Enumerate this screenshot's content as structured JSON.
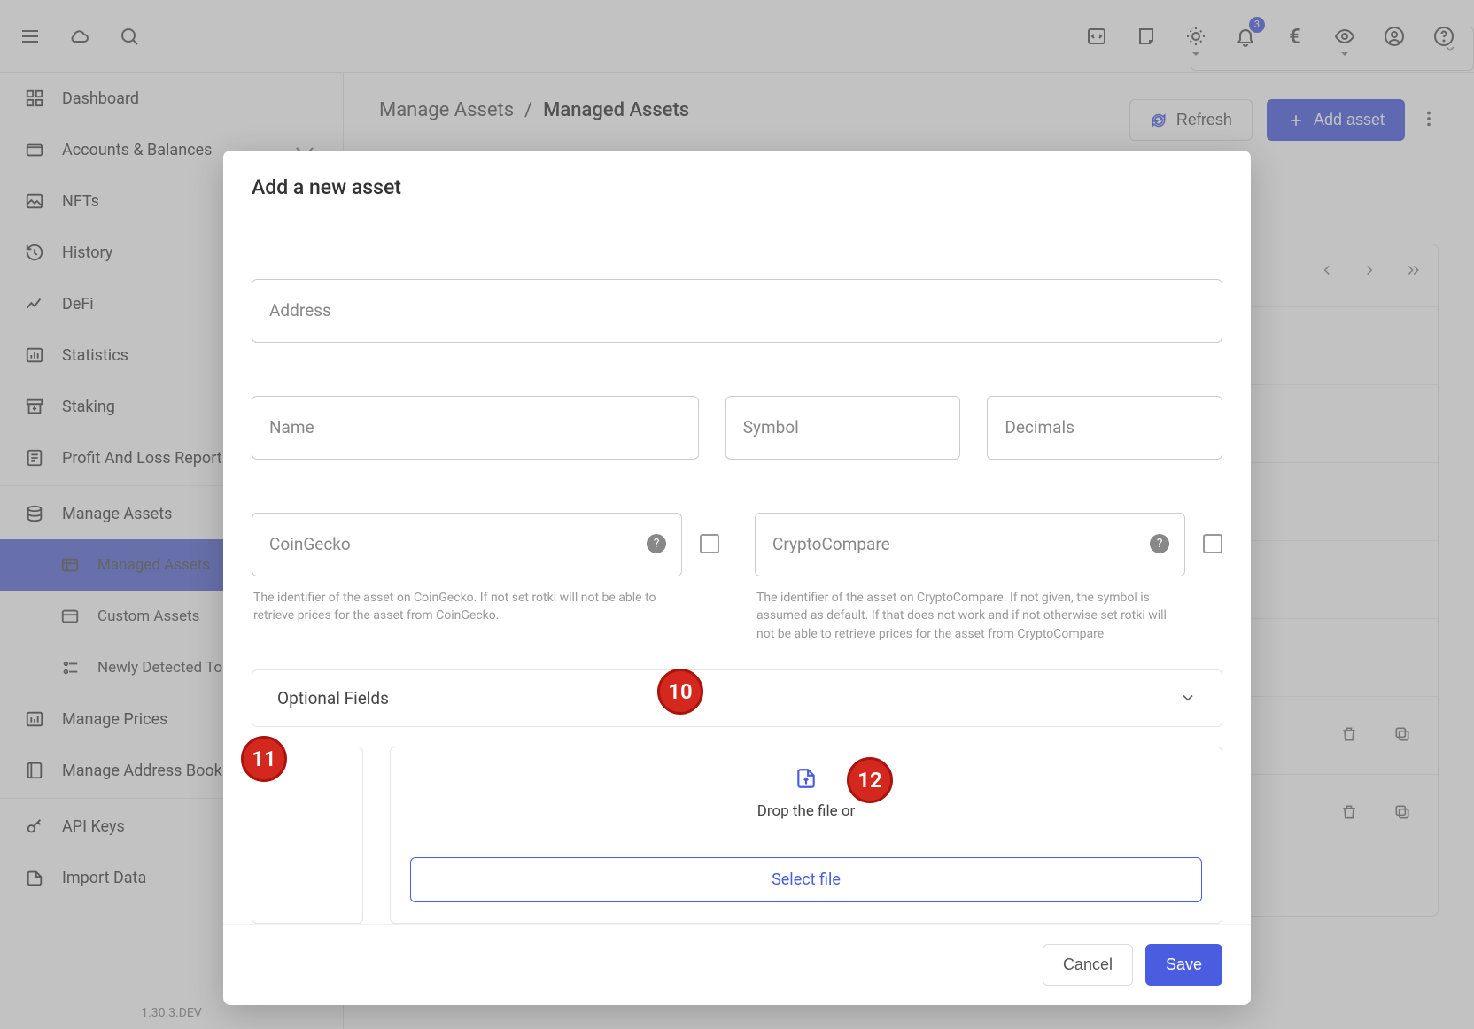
{
  "topbar": {
    "notifications_badge": "3"
  },
  "sidebar": {
    "items": [
      {
        "label": "Dashboard"
      },
      {
        "label": "Accounts & Balances"
      },
      {
        "label": "NFTs"
      },
      {
        "label": "History"
      },
      {
        "label": "DeFi"
      },
      {
        "label": "Statistics"
      },
      {
        "label": "Staking"
      },
      {
        "label": "Profit And Loss Report"
      },
      {
        "label": "Manage Assets"
      },
      {
        "label": "Managed Assets"
      },
      {
        "label": "Custom Assets"
      },
      {
        "label": "Newly Detected Tokens"
      },
      {
        "label": "Manage Prices"
      },
      {
        "label": "Manage Address Book"
      },
      {
        "label": "API Keys"
      },
      {
        "label": "Import Data"
      }
    ],
    "version": "1.30.3.DEV"
  },
  "breadcrumb": {
    "root": "Manage Assets",
    "sep": "/",
    "current": "Managed Assets"
  },
  "page_actions": {
    "refresh": "Refresh",
    "add_asset": "Add asset"
  },
  "modal": {
    "title": "Add a new asset",
    "fields": {
      "address": "Address",
      "name": "Name",
      "symbol": "Symbol",
      "decimals": "Decimals"
    },
    "oracles": {
      "coingecko": {
        "label": "CoinGecko",
        "hint": "The identifier of the asset on CoinGecko. If not set rotki will not be able to retrieve prices for the asset from CoinGecko."
      },
      "cryptocompare": {
        "label": "CryptoCompare",
        "hint": "The identifier of the asset on CryptoCompare. If not given, the symbol is assumed as default. If that does not work and if not otherwise set rotki will not be able to retrieve prices for the asset from CryptoCompare"
      }
    },
    "accordion": "Optional Fields",
    "dropzone": {
      "text": "Drop the file or",
      "select": "Select file"
    },
    "footer": {
      "cancel": "Cancel",
      "save": "Save"
    }
  },
  "markers": {
    "a": "10",
    "b": "11",
    "c": "12"
  }
}
